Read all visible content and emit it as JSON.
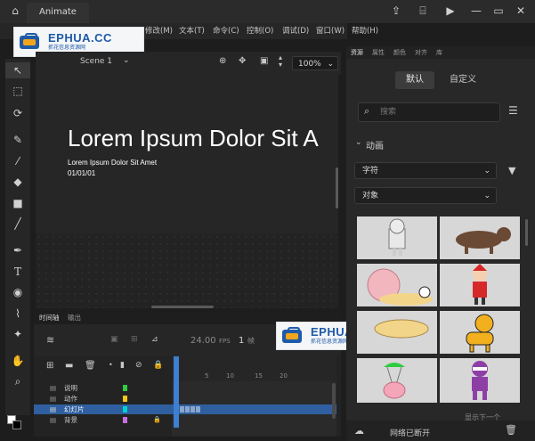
{
  "titlebar": {
    "app_tab": "Animate"
  },
  "menu": {
    "items": [
      "修改(M)",
      "文本(T)",
      "命令(C)",
      "控制(O)",
      "调试(D)",
      "窗口(W)",
      "帮助(H)"
    ]
  },
  "watermark": {
    "brand": "EPHUA.CC",
    "tagline": "抓花信息资源网"
  },
  "stage": {
    "scene_label": "Scene 1",
    "zoom_value": "100%",
    "title": "Lorem Ipsum Dolor Sit A",
    "subtitle": "Lorem Ipsum Dolor Sit Amet",
    "date": "01/01/01"
  },
  "timeline": {
    "tabs": [
      "时间轴",
      "输出"
    ],
    "fps": "24.00",
    "fps_unit": "FPS",
    "current_frame": "1",
    "frame_unit": "帧",
    "ruler_numbers": [
      "5",
      "10",
      "15",
      "20"
    ],
    "layers": [
      {
        "name": "说明",
        "color": "#2ecc40"
      },
      {
        "name": "动作",
        "color": "#f5c518"
      },
      {
        "name": "幻灯片",
        "color": "#00d2d2"
      },
      {
        "name": "背景",
        "color": "#c86ee0"
      }
    ]
  },
  "library": {
    "panel_tabs": [
      "资源",
      "属性",
      "颜色",
      "对齐",
      "库"
    ],
    "segment_default": "默认",
    "segment_custom": "自定义",
    "search_placeholder": "搜索",
    "section": "动画",
    "filter_character": "字符",
    "filter_object": "对象",
    "footer_status": "网络已断开",
    "footer_more": "显示下一个"
  },
  "colors": {
    "accent": "#3d7fd0",
    "watermark_blue": "#1e5aa8",
    "watermark_orange": "#f2a51c"
  }
}
